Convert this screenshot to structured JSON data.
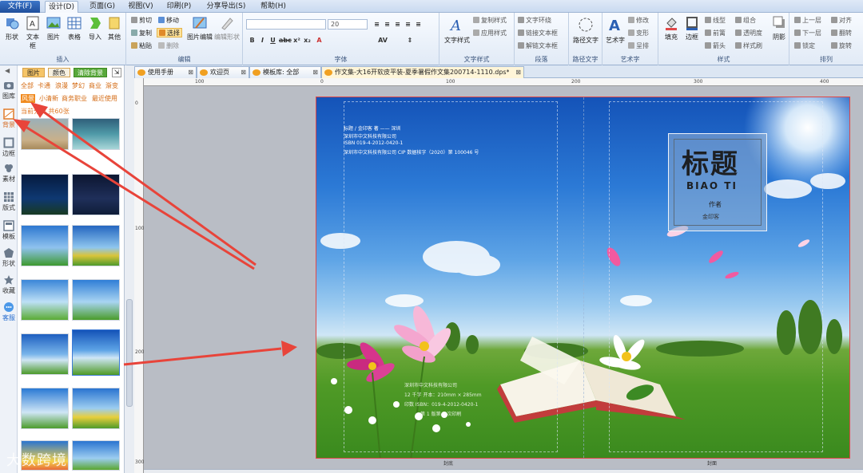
{
  "menu": {
    "tabs": [
      "文件(F)",
      "设计(D)",
      "页面(G)",
      "视图(V)",
      "印刷(P)",
      "分享导出(S)",
      "帮助(H)"
    ],
    "active": "设计(D)"
  },
  "ribbon": {
    "insert": {
      "label": "插入",
      "buttons": [
        "形状",
        "文本框",
        "图片",
        "表格",
        "导入",
        "其他"
      ]
    },
    "edit": {
      "label": "编辑",
      "items": [
        "剪切",
        "复制",
        "粘贴",
        "移动",
        "选择",
        "删除",
        "图片编辑",
        "编辑形状"
      ]
    },
    "font": {
      "label": "字体",
      "font_name": "",
      "font_size": "20"
    },
    "text_style": {
      "label": "文字样式",
      "big": "文字样式",
      "items": [
        "复制样式",
        "应用样式"
      ]
    },
    "paragraph": {
      "label": "段落",
      "items": [
        "文字环绕",
        "链接文本框",
        "解链文本框"
      ]
    },
    "path_text": {
      "label": "路径文字",
      "big": "路径文字"
    },
    "art_text": {
      "label": "艺术字",
      "big": "艺术字",
      "items": [
        "修改",
        "变形",
        "呈排"
      ]
    },
    "style": {
      "label": "样式",
      "items": [
        "填充",
        "边框",
        "线型",
        "箭头",
        "箭头",
        "前篱",
        "组合",
        "透明度",
        "样式刷",
        "阴影"
      ]
    },
    "arrange": {
      "label": "排列",
      "items": [
        "上一层",
        "下一层",
        "锁定",
        "对齐",
        "翻转",
        "旋转"
      ]
    }
  },
  "rail": {
    "items": [
      {
        "label": "图库",
        "icon": "gallery-icon"
      },
      {
        "label": "背景",
        "icon": "background-icon",
        "active": true
      },
      {
        "label": "边框",
        "icon": "border-icon"
      },
      {
        "label": "素材",
        "icon": "material-icon"
      },
      {
        "label": "版式",
        "icon": "layout-icon"
      },
      {
        "label": "模板",
        "icon": "template-icon"
      },
      {
        "label": "形状",
        "icon": "shape-icon"
      },
      {
        "label": "收藏",
        "icon": "star-icon"
      },
      {
        "label": "客服",
        "icon": "chat-icon"
      }
    ]
  },
  "library": {
    "tabs": [
      "图片",
      "颜色",
      "清除背景"
    ],
    "categories_row1": [
      "全部",
      "卡通",
      "浪漫",
      "梦幻",
      "商业",
      "渐变"
    ],
    "categories_row2": [
      "风景",
      "小清新",
      "商务职业",
      "最近使用"
    ],
    "selected_category": "风景",
    "count_text": "当前分类 共60张"
  },
  "doc_tabs": [
    {
      "label": "使用手册"
    },
    {
      "label": "欢迎页"
    },
    {
      "label": "模板库: 全部"
    },
    {
      "label": "作文集-大16开软皮平装-夏季暑假作文集200714-1110.dps*",
      "active": true
    }
  ],
  "rulers": {
    "h": [
      "100",
      "0",
      "100",
      "200",
      "300",
      "400"
    ],
    "v": [
      "0",
      "100",
      "200",
      "300"
    ]
  },
  "cover": {
    "back_lines": [
      "标题 / 金印客 著 —— 深圳",
      "深圳市中文科技有限公司",
      "ISBN   019-4-2012-0420-1",
      "深圳市中文科技有限公司 CIP 数据核字（2020）第 100046 号"
    ],
    "title": "标题",
    "title_pinyin": "BIAO TI",
    "author_label": "作者",
    "author": "金印客",
    "colophon": [
      "深圳市中文科技有限公司",
      "12 千字    开本：210mm × 285mm",
      "印数    ISBN：019-4-2012-0420-1",
      "第 1 版第 1 次印刷"
    ],
    "back_label": "封底",
    "front_label": "封面"
  },
  "watermark": "大数跨境",
  "colors": {
    "accent": "#f08a1e",
    "arrow": "#e8443a",
    "menu_blue": "#2a5fb3"
  }
}
